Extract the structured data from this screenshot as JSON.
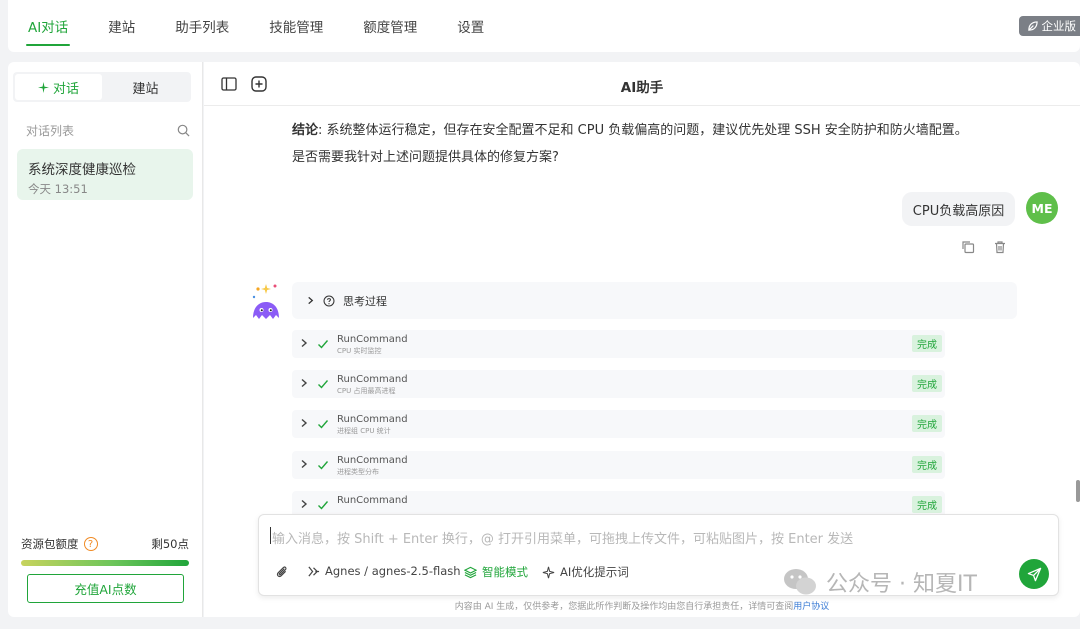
{
  "topnav": {
    "tabs": [
      {
        "label": "AI对话",
        "active": true
      },
      {
        "label": "建站",
        "active": false
      },
      {
        "label": "助手列表",
        "active": false
      },
      {
        "label": "技能管理",
        "active": false
      },
      {
        "label": "额度管理",
        "active": false
      },
      {
        "label": "设置",
        "active": false
      }
    ],
    "enterprise_badge": "企业版"
  },
  "sidebar": {
    "segments": [
      {
        "label": "对话",
        "icon": "sparkle-icon",
        "active": true
      },
      {
        "label": "建站",
        "active": false
      }
    ],
    "list_title": "对话列表",
    "conversations": [
      {
        "title": "系统深度健康巡检",
        "time": "今天 13:51"
      }
    ],
    "quota": {
      "label": "资源包额度",
      "remaining": "剩50点",
      "fill_fraction": 1.0,
      "recharge_label": "充值AI点数"
    }
  },
  "main": {
    "title": "AI助手",
    "assistant_text": {
      "conclusion_label": "结论",
      "conclusion_body": ": 系统整体运行稳定，但存在安全配置不足和 CPU 负载偏高的问题，建议优先处理 SSH 安全防护和防火墙配置。",
      "followup": "是否需要我针对上述问题提供具体的修复方案?"
    },
    "user_message": {
      "text": "CPU负载高原因",
      "avatar": "ME"
    },
    "thinking_label": "思考过程",
    "tool_calls": [
      {
        "name": "RunCommand",
        "desc": "CPU 实时监控",
        "status": "完成"
      },
      {
        "name": "RunCommand",
        "desc": "CPU 占用最高进程",
        "status": "完成"
      },
      {
        "name": "RunCommand",
        "desc": "进程组 CPU 统计",
        "status": "完成"
      },
      {
        "name": "RunCommand",
        "desc": "进程类型分布",
        "status": "完成"
      },
      {
        "name": "RunCommand",
        "desc": "",
        "status": "完成"
      }
    ],
    "composer": {
      "placeholder": "输入消息，按 Shift + Enter 换行，@ 打开引用菜单，可拖拽上传文件，可粘贴图片，按 Enter 发送",
      "model": "Agnes / agnes-2.5-flash",
      "smart_mode": "智能模式",
      "optimize": "AI优化提示词"
    },
    "disclaimer": "内容由 AI 生成，仅供参考，您据此所作判断及操作均由您自行承担责任，详情可查阅",
    "disclaimer_link": "用户协议"
  },
  "watermark": "公众号 · 知夏IT",
  "colors": {
    "accent": "#20a53a",
    "badge_bg": "#d9f2de"
  }
}
